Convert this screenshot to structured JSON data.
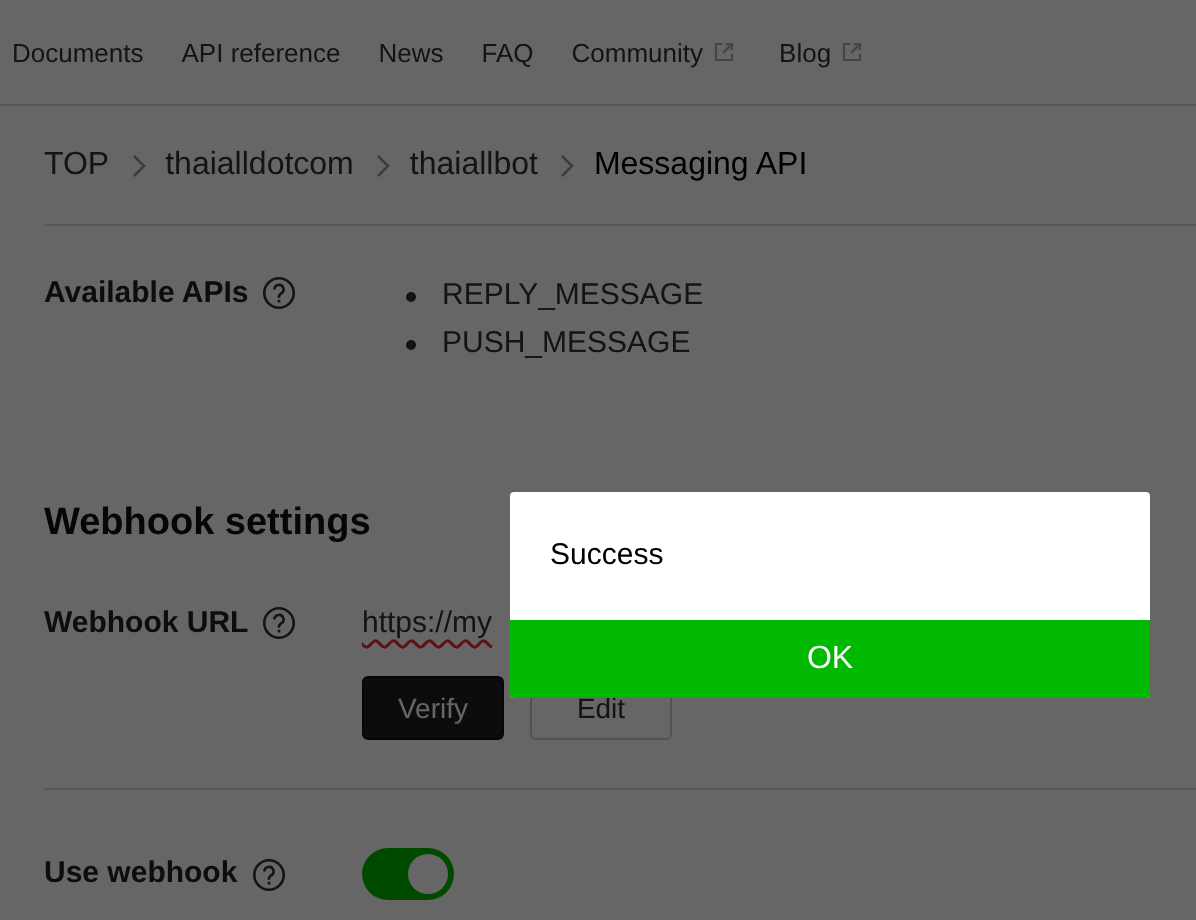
{
  "nav": [
    {
      "label": "Documents",
      "external": false
    },
    {
      "label": "API reference",
      "external": false
    },
    {
      "label": "News",
      "external": false
    },
    {
      "label": "FAQ",
      "external": false
    },
    {
      "label": "Community",
      "external": true
    },
    {
      "label": "Blog",
      "external": true
    }
  ],
  "breadcrumb": [
    "TOP",
    "thaialldotcom",
    "thaiallbot",
    "Messaging API"
  ],
  "available_apis": {
    "label": "Available APIs",
    "items": [
      "REPLY_MESSAGE",
      "PUSH_MESSAGE"
    ]
  },
  "webhook_settings": {
    "heading": "Webhook settings",
    "url_label": "Webhook URL",
    "url_value": "https://my",
    "buttons": [
      "Verify",
      "Edit"
    ],
    "use_label": "Use webhook",
    "use_on": true
  },
  "dialog": {
    "message": "Success",
    "button": "OK"
  }
}
